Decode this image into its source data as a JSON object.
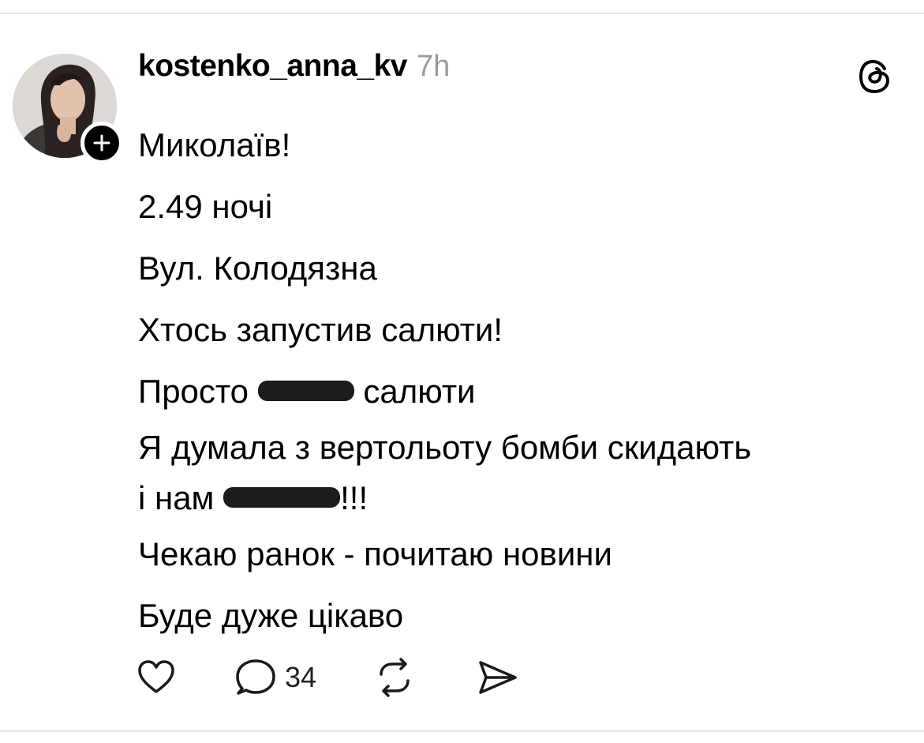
{
  "post": {
    "username": "kostenko_anna_kv",
    "time": "7h",
    "lines": [
      {
        "text": "Миколаїв!"
      },
      {
        "text": "2.49 ночі"
      },
      {
        "text": "Вул. Колодязна"
      },
      {
        "text": "Хтось запустив салюти!"
      },
      {
        "before": "Просто ",
        "after": " салюти"
      },
      {
        "text": "Я думала з вертольоту бомби скидають"
      },
      {
        "before": "і нам ",
        "after": "!!!"
      },
      {
        "text": "Чекаю ранок - почитаю новини"
      },
      {
        "text": "Буде дуже цікаво"
      }
    ],
    "reply_count": "34"
  },
  "icons": {
    "like": "heart-icon",
    "reply": "comment-icon",
    "repost": "repost-icon",
    "share": "send-icon",
    "app": "threads-logo-icon",
    "follow": "plus-icon"
  }
}
